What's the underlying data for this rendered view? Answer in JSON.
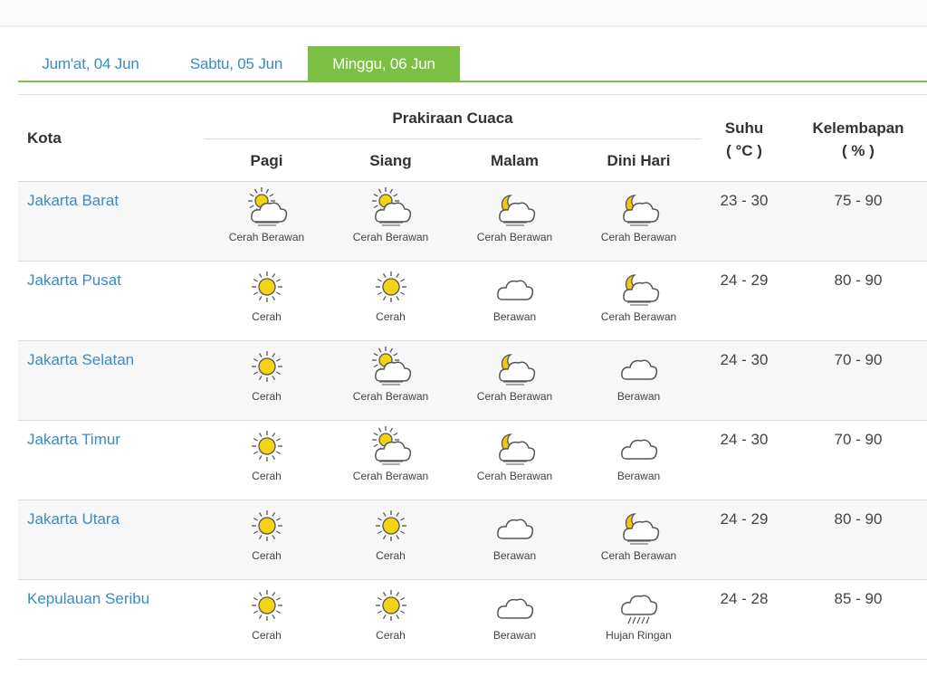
{
  "colors": {
    "accent": "#7ac143",
    "link": "#3a8bc6",
    "sun": "#f5d313",
    "moon": "#f2c80f",
    "text": "#333333"
  },
  "tabs": [
    {
      "label": "Jum'at, 04 Jun",
      "active": false
    },
    {
      "label": "Sabtu, 05 Jun",
      "active": false
    },
    {
      "label": "Minggu, 06 Jun",
      "active": true
    }
  ],
  "table": {
    "header": {
      "city": "Kota",
      "forecast": "Prakiraan Cuaca",
      "periods": [
        "Pagi",
        "Siang",
        "Malam",
        "Dini Hari"
      ],
      "temp_title": "Suhu",
      "temp_unit": "( °C )",
      "humidity_title": "Kelembapan",
      "humidity_unit": "( % )"
    },
    "rows": [
      {
        "city": "Jakarta Barat",
        "forecast": [
          {
            "icon": "partly-cloudy-day-icon",
            "label": "Cerah Berawan"
          },
          {
            "icon": "partly-cloudy-day-icon",
            "label": "Cerah Berawan"
          },
          {
            "icon": "partly-cloudy-night-icon",
            "label": "Cerah Berawan"
          },
          {
            "icon": "partly-cloudy-night-icon",
            "label": "Cerah Berawan"
          }
        ],
        "temp": "23 - 30",
        "humidity": "75 - 90"
      },
      {
        "city": "Jakarta Pusat",
        "forecast": [
          {
            "icon": "sun-icon",
            "label": "Cerah"
          },
          {
            "icon": "sun-icon",
            "label": "Cerah"
          },
          {
            "icon": "cloud-icon",
            "label": "Berawan"
          },
          {
            "icon": "partly-cloudy-night-icon",
            "label": "Cerah Berawan"
          }
        ],
        "temp": "24 - 29",
        "humidity": "80 - 90"
      },
      {
        "city": "Jakarta Selatan",
        "forecast": [
          {
            "icon": "sun-icon",
            "label": "Cerah"
          },
          {
            "icon": "partly-cloudy-day-icon",
            "label": "Cerah Berawan"
          },
          {
            "icon": "partly-cloudy-night-icon",
            "label": "Cerah Berawan"
          },
          {
            "icon": "cloud-icon",
            "label": "Berawan"
          }
        ],
        "temp": "24 - 30",
        "humidity": "70 - 90"
      },
      {
        "city": "Jakarta Timur",
        "forecast": [
          {
            "icon": "sun-icon",
            "label": "Cerah"
          },
          {
            "icon": "partly-cloudy-day-icon",
            "label": "Cerah Berawan"
          },
          {
            "icon": "partly-cloudy-night-icon",
            "label": "Cerah Berawan"
          },
          {
            "icon": "cloud-icon",
            "label": "Berawan"
          }
        ],
        "temp": "24 - 30",
        "humidity": "70 - 90"
      },
      {
        "city": "Jakarta Utara",
        "forecast": [
          {
            "icon": "sun-icon",
            "label": "Cerah"
          },
          {
            "icon": "sun-icon",
            "label": "Cerah"
          },
          {
            "icon": "cloud-icon",
            "label": "Berawan"
          },
          {
            "icon": "partly-cloudy-night-icon",
            "label": "Cerah Berawan"
          }
        ],
        "temp": "24 - 29",
        "humidity": "80 - 90"
      },
      {
        "city": "Kepulauan Seribu",
        "forecast": [
          {
            "icon": "sun-icon",
            "label": "Cerah"
          },
          {
            "icon": "sun-icon",
            "label": "Cerah"
          },
          {
            "icon": "cloud-icon",
            "label": "Berawan"
          },
          {
            "icon": "light-rain-icon",
            "label": "Hujan Ringan"
          }
        ],
        "temp": "24 - 28",
        "humidity": "85 - 90"
      }
    ]
  }
}
